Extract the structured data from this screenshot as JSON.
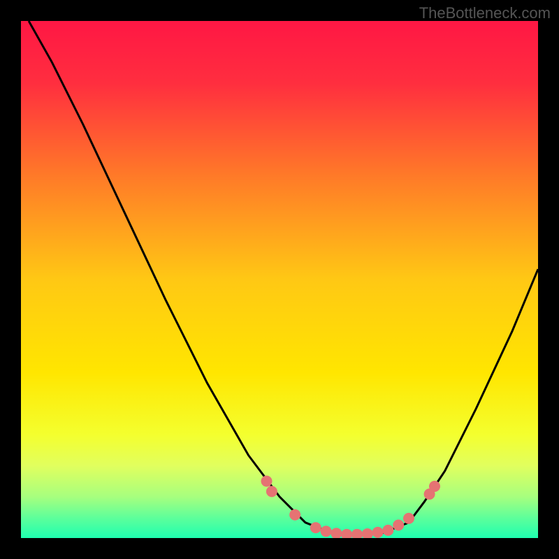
{
  "attribution": "TheBottleneck.com",
  "chart_data": {
    "type": "line",
    "title": "",
    "xlabel": "",
    "ylabel": "",
    "xlim": [
      0,
      100
    ],
    "ylim": [
      0,
      100
    ],
    "gradient_stops": [
      {
        "offset": 0.0,
        "color": "#ff1744"
      },
      {
        "offset": 0.12,
        "color": "#ff2e3f"
      },
      {
        "offset": 0.3,
        "color": "#ff7a28"
      },
      {
        "offset": 0.5,
        "color": "#ffc814"
      },
      {
        "offset": 0.68,
        "color": "#ffe600"
      },
      {
        "offset": 0.8,
        "color": "#f4ff2e"
      },
      {
        "offset": 0.86,
        "color": "#e1ff5e"
      },
      {
        "offset": 0.92,
        "color": "#a7ff7e"
      },
      {
        "offset": 0.96,
        "color": "#5fff9a"
      },
      {
        "offset": 1.0,
        "color": "#1fffb0"
      }
    ],
    "series": [
      {
        "name": "bottleneck-curve",
        "points": [
          {
            "x": 1.5,
            "y": 100
          },
          {
            "x": 6,
            "y": 92
          },
          {
            "x": 12,
            "y": 80
          },
          {
            "x": 20,
            "y": 63
          },
          {
            "x": 28,
            "y": 46
          },
          {
            "x": 36,
            "y": 30
          },
          {
            "x": 44,
            "y": 16
          },
          {
            "x": 50,
            "y": 8
          },
          {
            "x": 55,
            "y": 3
          },
          {
            "x": 60,
            "y": 1
          },
          {
            "x": 65,
            "y": 0.5
          },
          {
            "x": 70,
            "y": 1
          },
          {
            "x": 75,
            "y": 3
          },
          {
            "x": 78,
            "y": 7
          },
          {
            "x": 82,
            "y": 13
          },
          {
            "x": 88,
            "y": 25
          },
          {
            "x": 95,
            "y": 40
          },
          {
            "x": 100,
            "y": 52
          }
        ]
      }
    ],
    "markers": [
      {
        "x": 47.5,
        "y": 11
      },
      {
        "x": 48.5,
        "y": 9
      },
      {
        "x": 53,
        "y": 4.5
      },
      {
        "x": 57,
        "y": 2
      },
      {
        "x": 59,
        "y": 1.3
      },
      {
        "x": 61,
        "y": 0.9
      },
      {
        "x": 63,
        "y": 0.7
      },
      {
        "x": 65,
        "y": 0.7
      },
      {
        "x": 67,
        "y": 0.8
      },
      {
        "x": 69,
        "y": 1.1
      },
      {
        "x": 71,
        "y": 1.5
      },
      {
        "x": 73,
        "y": 2.5
      },
      {
        "x": 75,
        "y": 3.8
      },
      {
        "x": 79,
        "y": 8.5
      },
      {
        "x": 80,
        "y": 10
      }
    ],
    "marker_color": "#e57373",
    "marker_radius": 8
  }
}
